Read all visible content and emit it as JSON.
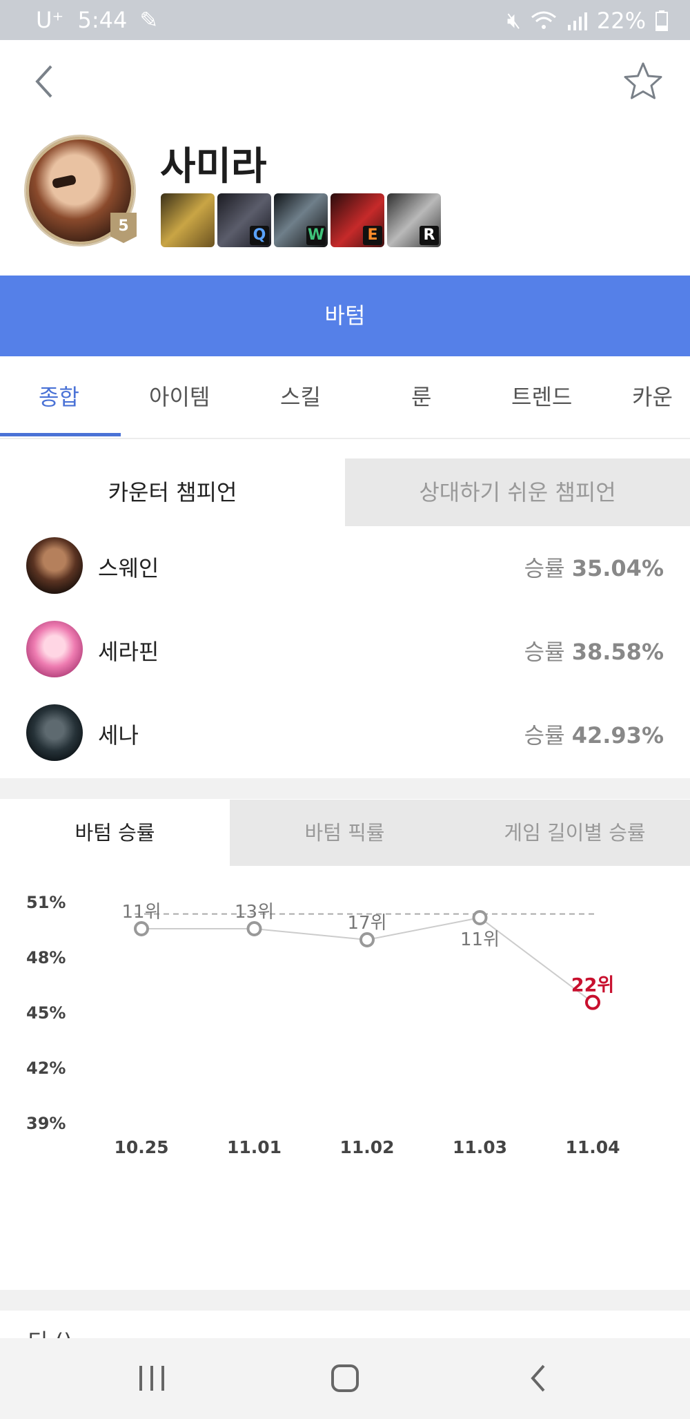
{
  "status_bar": {
    "carrier": "U⁺",
    "time": "5:44",
    "battery": "22%"
  },
  "header": {
    "champion_name": "사미라",
    "level": "5"
  },
  "skills": [
    {
      "icon": "passive-skill-icon",
      "key": ""
    },
    {
      "icon": "q-skill-icon",
      "key": "Q"
    },
    {
      "icon": "w-skill-icon",
      "key": "W"
    },
    {
      "icon": "e-skill-icon",
      "key": "E"
    },
    {
      "icon": "r-skill-icon",
      "key": "R"
    }
  ],
  "position": "바텀",
  "tabs": [
    "종합",
    "아이템",
    "스킬",
    "룬",
    "트렌드",
    "카운터"
  ],
  "counter_tabs": {
    "counter": "카운터 챔피언",
    "easy": "상대하기 쉬운 챔피언"
  },
  "counters": [
    {
      "name": "스웨인",
      "rate_label": "승률",
      "rate": "35.04%"
    },
    {
      "name": "세라핀",
      "rate_label": "승률",
      "rate": "38.58%"
    },
    {
      "name": "세나",
      "rate_label": "승률",
      "rate": "42.93%"
    }
  ],
  "chart_tabs": [
    "바텀 승률",
    "바텀 픽률",
    "게임 길이별 승률"
  ],
  "chart_data": {
    "type": "line",
    "x": [
      "10.25",
      "11.01",
      "11.02",
      "11.03",
      "11.04"
    ],
    "y_ticks": [
      "51%",
      "48%",
      "45%",
      "42%",
      "39%"
    ],
    "ylim": [
      39,
      51
    ],
    "series": [
      {
        "values": [
          49.5,
          49.5,
          48.9,
          50.1,
          45.5
        ],
        "rank_labels": [
          "11위",
          "13위",
          "17위",
          "11위",
          "22위"
        ]
      }
    ],
    "reference_line": 50.3,
    "highlight_color": "#c8102e",
    "line_color": "#cccccc",
    "marker_color": "#999999"
  },
  "bottom_partial_text": "티 ()"
}
